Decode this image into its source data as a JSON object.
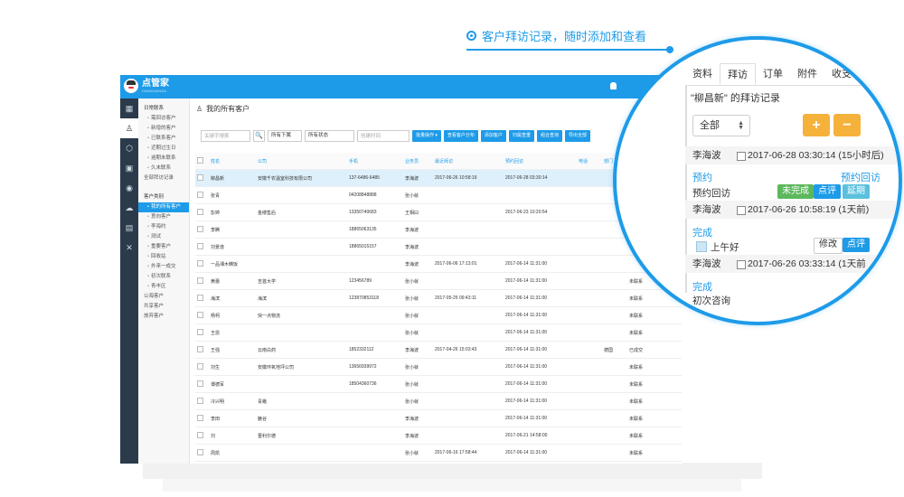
{
  "headline": {
    "text": "客户拜访记录，随时添加和查看"
  },
  "app": {
    "brand": "点管家",
    "brand_sub": "DIANGUANJIA",
    "sidebar_icons": [
      "grid-icon",
      "users-icon",
      "box-icon",
      "calendar-icon",
      "money-icon",
      "cloud-icon",
      "chart-icon",
      "tools-icon"
    ],
    "subnav": {
      "group1": "日常联系",
      "group1_items": [
        "需回访客户",
        "新增的客户",
        "已联系客户",
        "近期过生日",
        "逾期未联系",
        "久未联系",
        "全部拜访记录"
      ],
      "group2": "客户类别",
      "group2_items": [
        "我的所有客户",
        "意向客户",
        "李海约",
        "测试",
        "重要客户",
        "回收站",
        "外来一成交",
        "初次联系",
        "青丰区",
        "公海客户",
        "共享客户",
        "放弃客户"
      ]
    },
    "content_title": "我的所有客户",
    "toolbar": {
      "search_placeholder": "关键字搜索",
      "search_icon": "🔍",
      "sel_owner": "所有下属",
      "sel_status": "所有状态",
      "created_placeholder": "创建时间",
      "buttons": [
        "批量操作 ▾",
        "查看客户分布",
        "添加客户",
        "归属查重",
        "组合查询",
        "导出全部"
      ]
    },
    "table": {
      "headers": [
        "姓名",
        "公司",
        "手机",
        "业务员",
        "最近拜访",
        "预约回访",
        "电话",
        "部门",
        "状态"
      ],
      "rows": [
        [
          "柳昌新",
          "安徽千农温室科技有限公司",
          "137-6486-6485",
          "李海波",
          "2017-06-26 10:58:19",
          "2017-06-28 03:30:14",
          "",
          "",
          ""
        ],
        [
          "张青",
          "",
          "04208848888",
          "张小就",
          "",
          "",
          "",
          "",
          ""
        ],
        [
          "彭婷",
          "金缕售后",
          "13350740683",
          "王相曰",
          "",
          "2017-06-23 10:20:54",
          "",
          "",
          ""
        ],
        [
          "李腾",
          "",
          "18865063135",
          "李海波",
          "",
          "",
          "",
          "",
          ""
        ],
        [
          "刘景逸",
          "",
          "18865015157",
          "李海波",
          "",
          "",
          "",
          "",
          ""
        ],
        [
          "一品湘木精饭",
          "",
          "",
          "李海波",
          "2017-06-06 17:13:01",
          "2017-06-14 11:31:00",
          "",
          "",
          ""
        ],
        [
          "黄蕾",
          "吉首大学",
          "123456789",
          "张小就",
          "",
          "2017-06-14 11:31:00",
          "",
          "",
          "未联系"
        ],
        [
          "海滨",
          "海滨",
          "123870853118",
          "张小就",
          "2017-05-25 09:43:11",
          "2017-06-14 11:31:00",
          "",
          "",
          "未联系"
        ],
        [
          "杨柯",
          "快一点物流",
          "",
          "张小就",
          "",
          "2017-06-14 11:31:00",
          "",
          "",
          "未联系"
        ],
        [
          "王恩",
          "",
          "",
          "张小就",
          "",
          "2017-06-14 11:31:00",
          "",
          "",
          "未联系"
        ],
        [
          "王强",
          "云南白药",
          "1852332112",
          "李海波",
          "2017-04-26 15:03:43",
          "2017-06-14 11:31:00",
          "",
          "德国",
          "已成交"
        ],
        [
          "刘生",
          "安徽环氧地坪公司",
          "13656939972",
          "张小就",
          "",
          "2017-06-14 11:31:00",
          "",
          "",
          "未联系"
        ],
        [
          "谭德军",
          "",
          "18504360736",
          "张小就",
          "",
          "2017-06-14 11:31:00",
          "",
          "",
          "未联系"
        ],
        [
          "冷兴明",
          "青蛾",
          "",
          "张小就",
          "",
          "2017-06-14 11:31:00",
          "",
          "",
          "未联系"
        ],
        [
          "李田",
          "魅谷",
          "",
          "李海波",
          "",
          "2017-06-14 11:31:00",
          "",
          "",
          "未联系"
        ],
        [
          "刘",
          "晋利尔德",
          "",
          "李海波",
          "",
          "2017-06-21 14:58:00",
          "",
          "",
          "未联系"
        ],
        [
          "周凯",
          "",
          "",
          "张小就",
          "2017-06-16 17:58:44",
          "2017-06-14 11:31:00",
          "",
          "",
          "未联系"
        ],
        [
          "李战锋",
          "",
          "",
          "张小就",
          "2017-05-31 11:45:27",
          "2017-06-14 11:31:00",
          "",
          "",
          "未联系"
        ],
        [
          "于寒",
          "白山电视台",
          "17194419999",
          "李海波",
          "",
          "2017-04-07 10:35:00",
          "",
          "",
          "未联系"
        ]
      ]
    }
  },
  "zoom": {
    "tabs": [
      "资料",
      "拜访",
      "订单",
      "附件",
      "收支"
    ],
    "panel_title": "\"柳昌新\" 的拜访记录",
    "filter_value": "全部",
    "add_label": "+",
    "minus_label": "−",
    "records": [
      {
        "who": "李海波",
        "datetime": "2017-06-28 03:30:14 (15小时后)",
        "type": "预约",
        "type_right": "预约回访",
        "desc": "预约回访",
        "btns": [
          "未完成",
          "点评",
          "延期"
        ]
      },
      {
        "who": "李海波",
        "datetime": "2017-06-26 10:58:19 (1天前)",
        "type": "完成",
        "desc": "上午好",
        "btns": [
          "修改",
          "点评"
        ]
      },
      {
        "who": "李海波",
        "datetime": "2017-06-26 03:33:14 (1天前",
        "type": "完成",
        "desc": "初次咨询"
      }
    ]
  }
}
